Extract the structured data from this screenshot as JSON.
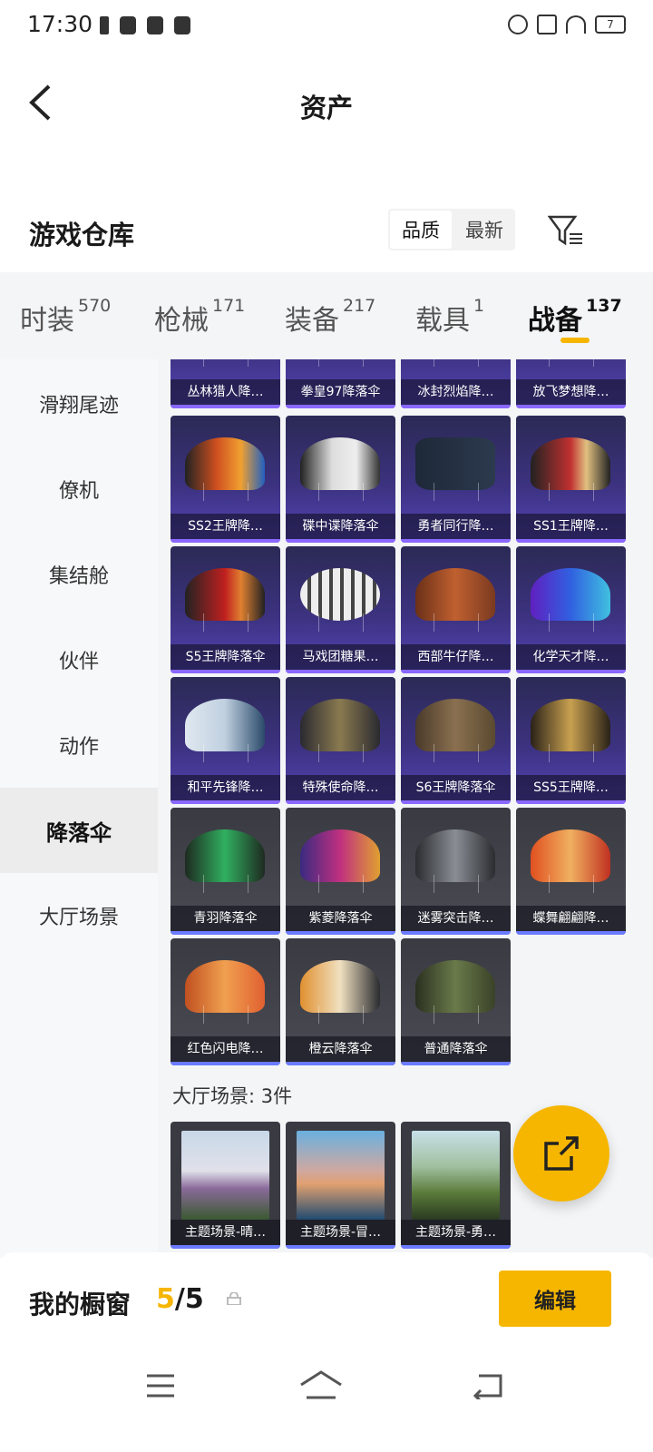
{
  "status": {
    "time": "17:30",
    "battery": "7"
  },
  "header": {
    "title": "资产"
  },
  "warehouse": {
    "title": "游戏仓库",
    "sort_quality": "品质",
    "sort_newest": "最新"
  },
  "tabs": [
    {
      "label": "时装",
      "count": "570"
    },
    {
      "label": "枪械",
      "count": "171"
    },
    {
      "label": "装备",
      "count": "217"
    },
    {
      "label": "载具",
      "count": "1"
    },
    {
      "label": "战备",
      "count": "137"
    }
  ],
  "sidebar": {
    "items": [
      "滑翔尾迹",
      "僚机",
      "集结舱",
      "伙伴",
      "动作",
      "降落伞",
      "大厅场景"
    ]
  },
  "cards": {
    "row0": [
      "丛林猎人降…",
      "拳皇97降落伞",
      "冰封烈焰降…",
      "放飞梦想降…"
    ],
    "row1": [
      "SS2王牌降…",
      "碟中谍降落伞",
      "勇者同行降…",
      "SS1王牌降…"
    ],
    "row2": [
      "S5王牌降落伞",
      "马戏团糖果…",
      "西部牛仔降…",
      "化学天才降…"
    ],
    "row3": [
      "和平先锋降…",
      "特殊使命降…",
      "S6王牌降落伞",
      "SS5王牌降…"
    ],
    "row4": [
      "青羽降落伞",
      "紫菱降落伞",
      "迷雾突击降…",
      "蝶舞翩翩降…"
    ],
    "row5": [
      "红色闪电降…",
      "橙云降落伞",
      "普通降落伞"
    ]
  },
  "lobby_section": {
    "label": "大厅场景: 3件",
    "cards": [
      "主题场景-晴…",
      "主题场景-冒…",
      "主题场景-勇…"
    ]
  },
  "showcase": {
    "title": "我的橱窗",
    "current": "5",
    "separator": "/",
    "total": "5",
    "edit_label": "编辑"
  },
  "colors": {
    "accent": "#f6b600",
    "purple_card": "#3c3280",
    "gray_card": "#4a4b53"
  }
}
